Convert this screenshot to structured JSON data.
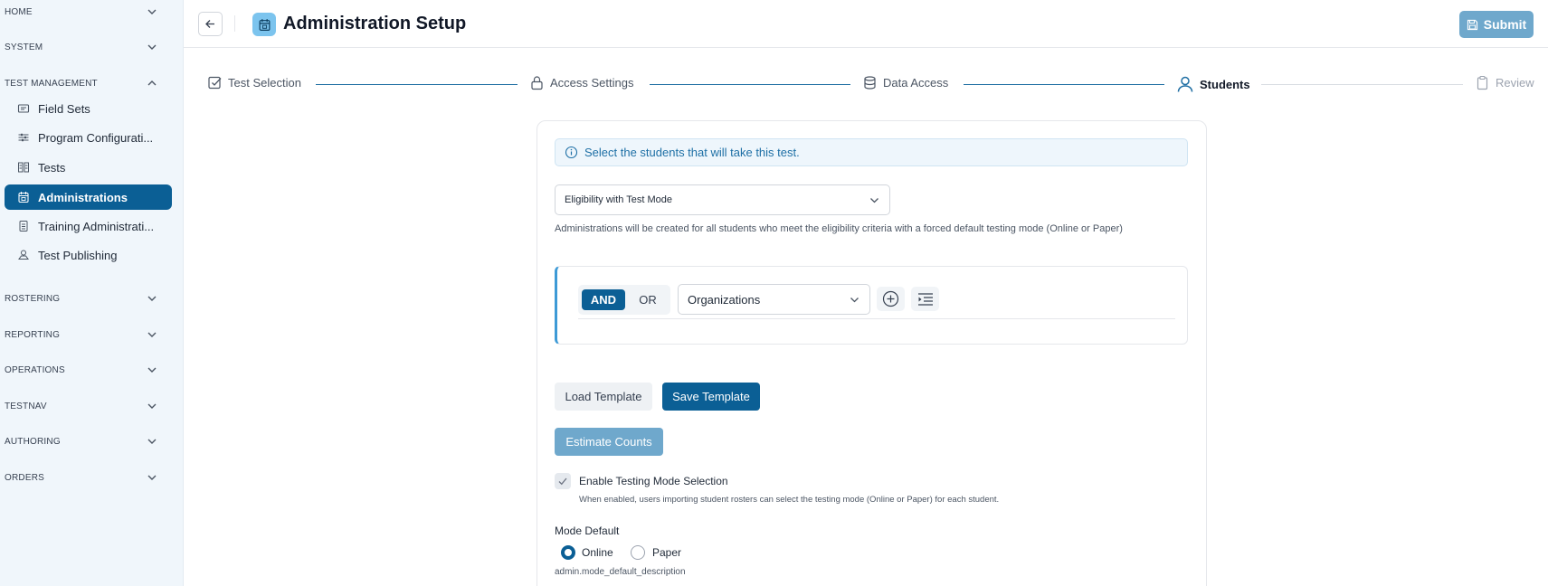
{
  "sidebar": {
    "sections": {
      "home": "HOME",
      "system": "SYSTEM",
      "test_management": "TEST MANAGEMENT",
      "rostering": "ROSTERING",
      "reporting": "REPORTING",
      "operations": "OPERATIONS",
      "testnav": "TESTNAV",
      "authoring": "AUTHORING",
      "orders": "ORDERS"
    },
    "items": [
      {
        "label": "Field Sets",
        "icon": "field-sets-icon"
      },
      {
        "label": "Program Configurati...",
        "icon": "sliders-icon"
      },
      {
        "label": "Tests",
        "icon": "tests-icon"
      },
      {
        "label": "Administrations",
        "icon": "calendar-icon",
        "active": true
      },
      {
        "label": "Training Administrati...",
        "icon": "training-icon"
      },
      {
        "label": "Test Publishing",
        "icon": "publish-icon"
      }
    ]
  },
  "header": {
    "title": "Administration Setup",
    "submit_label": "Submit"
  },
  "stepper": {
    "steps": [
      {
        "label": "Test Selection",
        "state": "done"
      },
      {
        "label": "Access Settings",
        "state": "done"
      },
      {
        "label": "Data Access",
        "state": "done"
      },
      {
        "label": "Students",
        "state": "active"
      },
      {
        "label": "Review",
        "state": "upcoming"
      }
    ]
  },
  "main": {
    "info_text": "Select the students that will take this test.",
    "eligibility_select": "Eligibility with Test Mode",
    "eligibility_description": "Administrations will be created for all students who meet the eligibility criteria with a forced default testing mode (Online or Paper)",
    "rule": {
      "and_label": "AND",
      "or_label": "OR",
      "field_select": "Organizations"
    },
    "load_template_label": "Load Template",
    "save_template_label": "Save Template",
    "estimate_counts_label": "Estimate Counts",
    "enable_mode_label": "Enable Testing Mode Selection",
    "enable_mode_description": "When enabled, users importing student rosters can select the testing mode (Online or Paper) for each student.",
    "mode_default_label": "Mode Default",
    "mode_online": "Online",
    "mode_paper": "Paper",
    "mode_default_description": "admin.mode_default_description"
  },
  "colors": {
    "primary": "#0b5f95",
    "primary_light": "#6fa8cc",
    "sidebar_bg": "#f0f6fb",
    "info_text": "#1d6fa5"
  }
}
